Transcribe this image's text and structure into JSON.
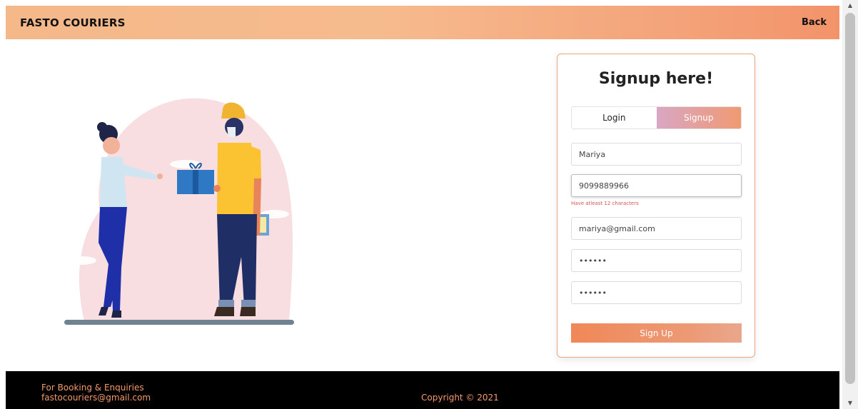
{
  "navbar": {
    "brand": "FASTO COURIERS",
    "back_label": "Back"
  },
  "signup_card": {
    "title": "Signup here!",
    "tabs": [
      {
        "label": "Login",
        "active": false
      },
      {
        "label": "Signup",
        "active": true
      }
    ],
    "fields": {
      "name": {
        "value": "Mariya"
      },
      "phone": {
        "value": "9099889966",
        "error": "Have atleast 12 characters"
      },
      "email": {
        "value": "mariya@gmail.com"
      },
      "password": {
        "value": "••••••"
      },
      "confirm_password": {
        "value": "••••••"
      }
    },
    "submit_label": "Sign Up"
  },
  "footer": {
    "enquiry_line1": "For Booking & Enquiries",
    "enquiry_line2": "fastocouriers@gmail.com",
    "copyright": "Copyright © 2021"
  },
  "colors": {
    "accent": "#f3936a",
    "navbar_gradient_start": "#f4b889",
    "error": "#d9534f",
    "footer_text": "#f49a6c"
  }
}
